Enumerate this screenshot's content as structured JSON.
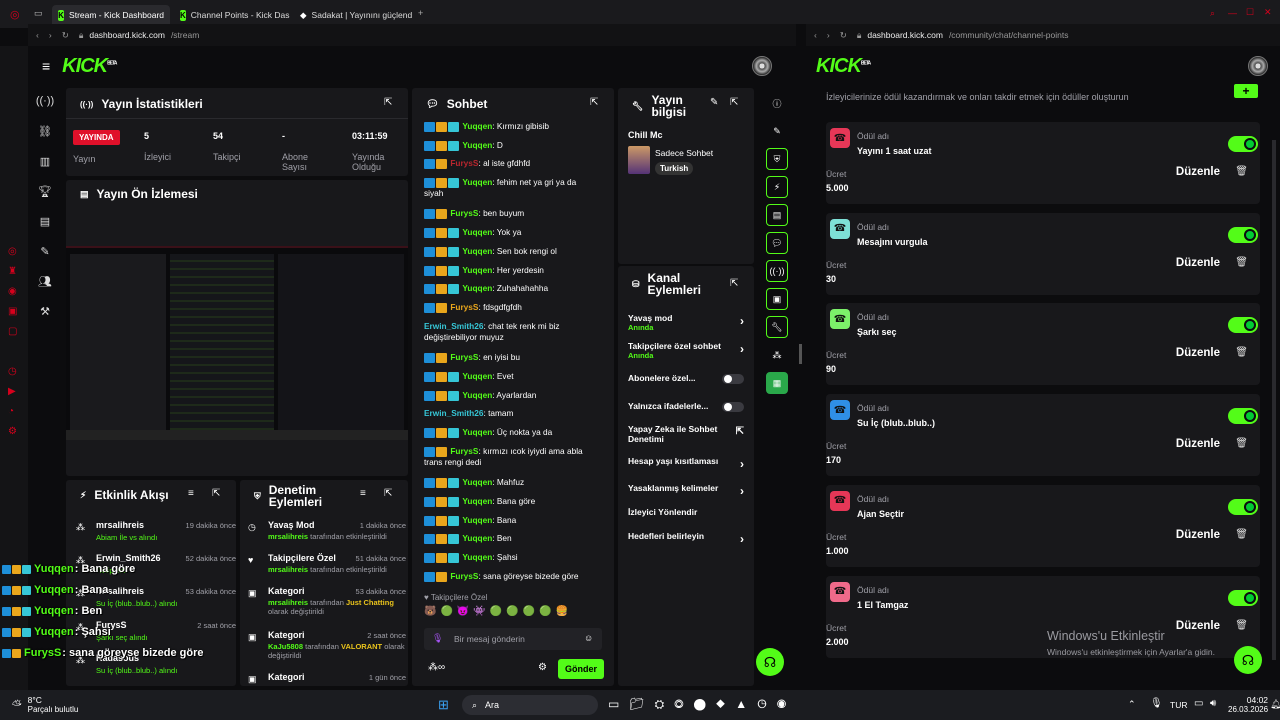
{
  "browser": {
    "tabs": [
      {
        "label": "Stream - Kick Dashboard"
      },
      {
        "label": "Channel Points - Kick Das"
      },
      {
        "label": "Sadakat | Yayınını güçlend"
      }
    ],
    "url_left_host": "dashboard.kick.com",
    "url_left_path": "/stream",
    "url_right_host": "dashboard.kick.com",
    "url_right_path": "/community/chat/channel-points"
  },
  "left": {
    "logo": "KICK",
    "logo_beta": "BETA",
    "stats": {
      "title": "Yayın İstatistikleri",
      "live_badge": "YAYINDA",
      "items": [
        {
          "value": "",
          "label": "Yayın"
        },
        {
          "value": "5",
          "label": "İzleyici"
        },
        {
          "value": "54",
          "label": "Takipçi"
        },
        {
          "value": "-",
          "label": "Abone Sayısı"
        },
        {
          "value": "03:11:59",
          "label": "Yayında Olduğu"
        }
      ]
    },
    "preview": {
      "title": "Yayın Ön İzlemesi"
    },
    "chat": {
      "title": "Sohbet",
      "messages": [
        {
          "user": "Yuqqen",
          "color": "#53fc18",
          "text": ": Kırmızı gibisib",
          "badges": 3
        },
        {
          "user": "Yuqqen",
          "color": "#53fc18",
          "text": ": D",
          "badges": 3
        },
        {
          "user": "FurysS",
          "color": "#b9262e",
          "text": ": al iste gfdhfd",
          "badges": 2
        },
        {
          "user": "Yuqqen",
          "color": "#53fc18",
          "text": ": fehim net ya gri ya da siyah",
          "badges": 3
        },
        {
          "user": "FurysS",
          "color": "#53fc18",
          "text": ": ben buyum",
          "badges": 2
        },
        {
          "user": "Yuqqen",
          "color": "#53fc18",
          "text": ": Yok ya",
          "badges": 3
        },
        {
          "user": "Yuqqen",
          "color": "#53fc18",
          "text": ": Sen bok rengi ol",
          "badges": 3
        },
        {
          "user": "Yuqqen",
          "color": "#53fc18",
          "text": ": Her yerdesin",
          "badges": 3
        },
        {
          "user": "Yuqqen",
          "color": "#53fc18",
          "text": ": Zuhahahahha",
          "badges": 3
        },
        {
          "user": "FurysS",
          "color": "#e9a61c",
          "text": ": fdsgdfgfdh",
          "badges": 2
        },
        {
          "user": "Erwin_Smith26",
          "color": "#36c6d6",
          "text": ": chat tek renk mi biz değiştirebiliyor muyuz",
          "badges": 0
        },
        {
          "user": "FurysS",
          "color": "#53fc18",
          "text": ": en iyisi bu",
          "badges": 2
        },
        {
          "user": "Yuqqen",
          "color": "#53fc18",
          "text": ": Evet",
          "badges": 3
        },
        {
          "user": "Yuqqen",
          "color": "#53fc18",
          "text": ": Ayarlardan",
          "badges": 3
        },
        {
          "user": "Erwin_Smith26",
          "color": "#36c6d6",
          "text": ": tamam",
          "badges": 0
        },
        {
          "user": "Yuqqen",
          "color": "#53fc18",
          "text": ": Üç nokta ya da",
          "badges": 3
        },
        {
          "user": "FurysS",
          "color": "#53fc18",
          "text": ": kırmızı ıcok iyiydi ama abla trans rengi dedi",
          "badges": 2
        },
        {
          "user": "Yuqqen",
          "color": "#53fc18",
          "text": ": Mahfuz",
          "badges": 3
        },
        {
          "user": "Yuqqen",
          "color": "#53fc18",
          "text": ": Bana göre",
          "badges": 3
        },
        {
          "user": "Yuqqen",
          "color": "#53fc18",
          "text": ": Bana",
          "badges": 3
        },
        {
          "user": "Yuqqen",
          "color": "#53fc18",
          "text": ": Ben",
          "badges": 3
        },
        {
          "user": "Yuqqen",
          "color": "#53fc18",
          "text": ": Şahsi",
          "badges": 3
        },
        {
          "user": "FurysS",
          "color": "#53fc18",
          "text": ": sana göreyse bizede göre",
          "badges": 2
        }
      ],
      "followers_only": "Takipçilere Özel",
      "input_placeholder": "Bir mesaj gönderin",
      "send_label": "Gönder"
    },
    "stream_info": {
      "title": "Yayın bilgisi",
      "stream_title": "Chill Mc",
      "category": "Sadece Sohbet",
      "language": "Turkish"
    },
    "channel_actions": {
      "title": "Kanal Eylemleri",
      "items": [
        {
          "label": "Yavaş mod",
          "sub": "Anında"
        },
        {
          "label": "Takipçilere özel sohbet",
          "sub": "Anında"
        },
        {
          "label": "Abonelere özel...",
          "sub": ""
        },
        {
          "label": "Yalnızca ifadelerle...",
          "sub": ""
        },
        {
          "label": "Yapay Zeka ile Sohbet Denetimi",
          "sub": ""
        },
        {
          "label": "Hesap yaşı kısıtlaması",
          "sub": ""
        },
        {
          "label": "Yasaklanmış kelimeler",
          "sub": ""
        },
        {
          "label": "İzleyici Yönlendir",
          "sub": ""
        },
        {
          "label": "Hedefleri belirleyin",
          "sub": ""
        }
      ]
    },
    "activity": {
      "title": "Etkinlik Akışı",
      "items": [
        {
          "user": "mrsalihreis",
          "time": "19 dakika önce",
          "desc": "Abiam İle vs alındı"
        },
        {
          "user": "Erwin_Smith26",
          "time": "52 dakika önce",
          "desc": "Takip etti"
        },
        {
          "user": "mrsalihreis",
          "time": "53 dakika önce",
          "desc": "Su İç (blub..blub..) alındı"
        },
        {
          "user": "FurysS",
          "time": "2 saat önce",
          "desc": "Şarkı seç alındı"
        },
        {
          "user": "Kadasous",
          "time": "",
          "desc": "Su İç (blub..blub..) alındı"
        }
      ]
    },
    "moderation": {
      "title": "Denetim Eylemleri",
      "items": [
        {
          "title": "Yavaş Mod",
          "time": "1 dakika önce",
          "user": "mrsalihreis",
          "desc": "tarafından etkinleştirildi",
          "extra": ""
        },
        {
          "title": "Takipçilere Özel",
          "time": "51 dakika önce",
          "user": "mrsalihreis",
          "desc": "tarafından etkinleştirildi",
          "extra": ""
        },
        {
          "title": "Kategori",
          "time": "53 dakika önce",
          "user": "mrsalihreis",
          "desc": "tarafından",
          "extra": "Just Chatting",
          "tail": "olarak değiştirildi"
        },
        {
          "title": "Kategori",
          "time": "2 saat önce",
          "user": "KaJu5808",
          "desc": "tarafından",
          "extra": "VALORANT",
          "tail": "olarak değiştirildi"
        },
        {
          "title": "Kategori",
          "time": "1 gün önce",
          "user": "",
          "desc": "",
          "extra": ""
        }
      ]
    }
  },
  "overlay_chat": [
    {
      "user": "Yuqqen",
      "text": ": Bana göre"
    },
    {
      "user": "Yuqqen",
      "text": ": Bana"
    },
    {
      "user": "Yuqqen",
      "text": ": Ben"
    },
    {
      "user": "Yuqqen",
      "text": ": Şahsi"
    },
    {
      "user": "FurysS",
      "text": ": sana göreyse bizede göre"
    }
  ],
  "right": {
    "logo": "KICK",
    "logo_beta": "BETA",
    "intro": "İzleyicilerinize ödül kazandırmak ve onları takdir etmek için ödüller oluşturun",
    "reward_name_label": "Ödül adı",
    "cost_label": "Ücret",
    "edit_label": "Düzenle",
    "rewards": [
      {
        "name": "Yayını 1 saat uzat",
        "cost": "5.000",
        "color": "#e63757"
      },
      {
        "name": "Mesajını vurgula",
        "cost": "30",
        "color": "#7ee0d6"
      },
      {
        "name": "Şarkı seç",
        "cost": "90",
        "color": "#7cf06a"
      },
      {
        "name": "Su İç (blub..blub..)",
        "cost": "170",
        "color": "#2f8fe6"
      },
      {
        "name": "Ajan Seçtir",
        "cost": "1.000",
        "color": "#e63757"
      },
      {
        "name": "1 El Tamgaz",
        "cost": "2.000",
        "color": "#f06a8a"
      }
    ],
    "watermark_title": "Windows'u Etkinleştir",
    "watermark_sub": "Windows'u etkinleştirmek için Ayarlar'a gidin."
  },
  "taskbar": {
    "weather_temp": "8°C",
    "weather_desc": "Parçalı bulutlu",
    "search": "Ara",
    "lang": "TUR",
    "time": "04:02",
    "date": "26.03.2026"
  }
}
